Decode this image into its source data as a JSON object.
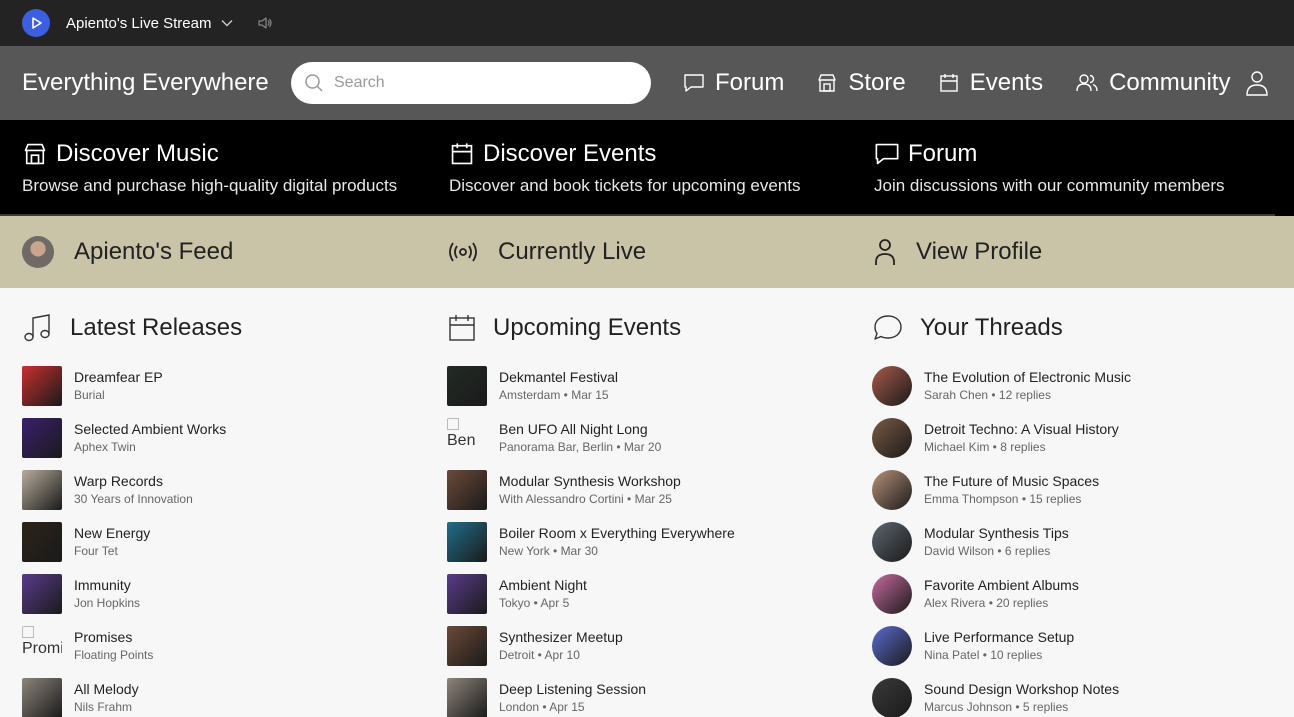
{
  "topbar": {
    "stream_title": "Apiento's Live Stream"
  },
  "navbar": {
    "brand": "Everything Everywhere",
    "search_placeholder": "Search",
    "items": [
      {
        "label": "Forum",
        "icon": "chat-icon"
      },
      {
        "label": "Store",
        "icon": "store-icon"
      },
      {
        "label": "Events",
        "icon": "calendar-icon"
      },
      {
        "label": "Community",
        "icon": "users-icon"
      }
    ]
  },
  "discover": [
    {
      "title": "Discover Music",
      "desc": "Browse and purchase high-quality digital products",
      "icon": "store-icon"
    },
    {
      "title": "Discover Events",
      "desc": "Discover and book tickets for upcoming events",
      "icon": "calendar-icon"
    },
    {
      "title": "Forum",
      "desc": "Join discussions with our community members",
      "icon": "chat-icon"
    }
  ],
  "feedbar": [
    {
      "label": "Apiento's Feed",
      "icon": "avatar"
    },
    {
      "label": "Currently Live",
      "icon": "broadcast-icon"
    },
    {
      "label": "View Profile",
      "icon": "user-icon"
    }
  ],
  "releases": {
    "title": "Latest Releases",
    "items": [
      {
        "title": "Dreamfear EP",
        "sub": "Burial",
        "color": "#c8302f"
      },
      {
        "title": "Selected Ambient Works",
        "sub": "Aphex Twin",
        "color": "#3a1f6e"
      },
      {
        "title": "Warp Records",
        "sub": "30 Years of Innovation",
        "color": "#b8ad9c"
      },
      {
        "title": "New Energy",
        "sub": "Four Tet",
        "color": "#2b2318"
      },
      {
        "title": "Immunity",
        "sub": "Jon Hopkins",
        "color": "#5a3b8c"
      },
      {
        "title": "Promises",
        "sub": "Floating Points",
        "broken": "Promi"
      },
      {
        "title": "All Melody",
        "sub": "Nils Frahm",
        "color": "#8d857a"
      }
    ]
  },
  "events": {
    "title": "Upcoming Events",
    "items": [
      {
        "title": "Dekmantel Festival",
        "sub": "Amsterdam • Mar 15",
        "color": "#232a25"
      },
      {
        "title": "Ben UFO All Night Long",
        "sub": "Panorama Bar, Berlin • Mar 20",
        "broken": "Ben"
      },
      {
        "title": "Modular Synthesis Workshop",
        "sub": "With Alessandro Cortini • Mar 25",
        "color": "#6b4a38"
      },
      {
        "title": "Boiler Room x Everything Everywhere",
        "sub": "New York • Mar 30",
        "color": "#1f6f8a"
      },
      {
        "title": "Ambient Night",
        "sub": "Tokyo • Apr 5",
        "color": "#5a3b8c"
      },
      {
        "title": "Synthesizer Meetup",
        "sub": "Detroit • Apr 10",
        "color": "#6b4a38"
      },
      {
        "title": "Deep Listening Session",
        "sub": "London • Apr 15",
        "color": "#8d857a"
      }
    ]
  },
  "threads": {
    "title": "Your Threads",
    "items": [
      {
        "title": "The Evolution of Electronic Music",
        "sub": "Sarah Chen • 12 replies",
        "color": "#a85a4a"
      },
      {
        "title": "Detroit Techno: A Visual History",
        "sub": "Michael Kim • 8 replies",
        "color": "#7a5a44"
      },
      {
        "title": "The Future of Music Spaces",
        "sub": "Emma Thompson • 15 replies",
        "color": "#b8917a"
      },
      {
        "title": "Modular Synthesis Tips",
        "sub": "David Wilson • 6 replies",
        "color": "#5c6670"
      },
      {
        "title": "Favorite Ambient Albums",
        "sub": "Alex Rivera • 20 replies",
        "color": "#c86aa0"
      },
      {
        "title": "Live Performance Setup",
        "sub": "Nina Patel • 10 replies",
        "color": "#5b6bd0"
      },
      {
        "title": "Sound Design Workshop Notes",
        "sub": "Marcus Johnson • 5 replies",
        "color": "#3a3a3a"
      }
    ]
  }
}
